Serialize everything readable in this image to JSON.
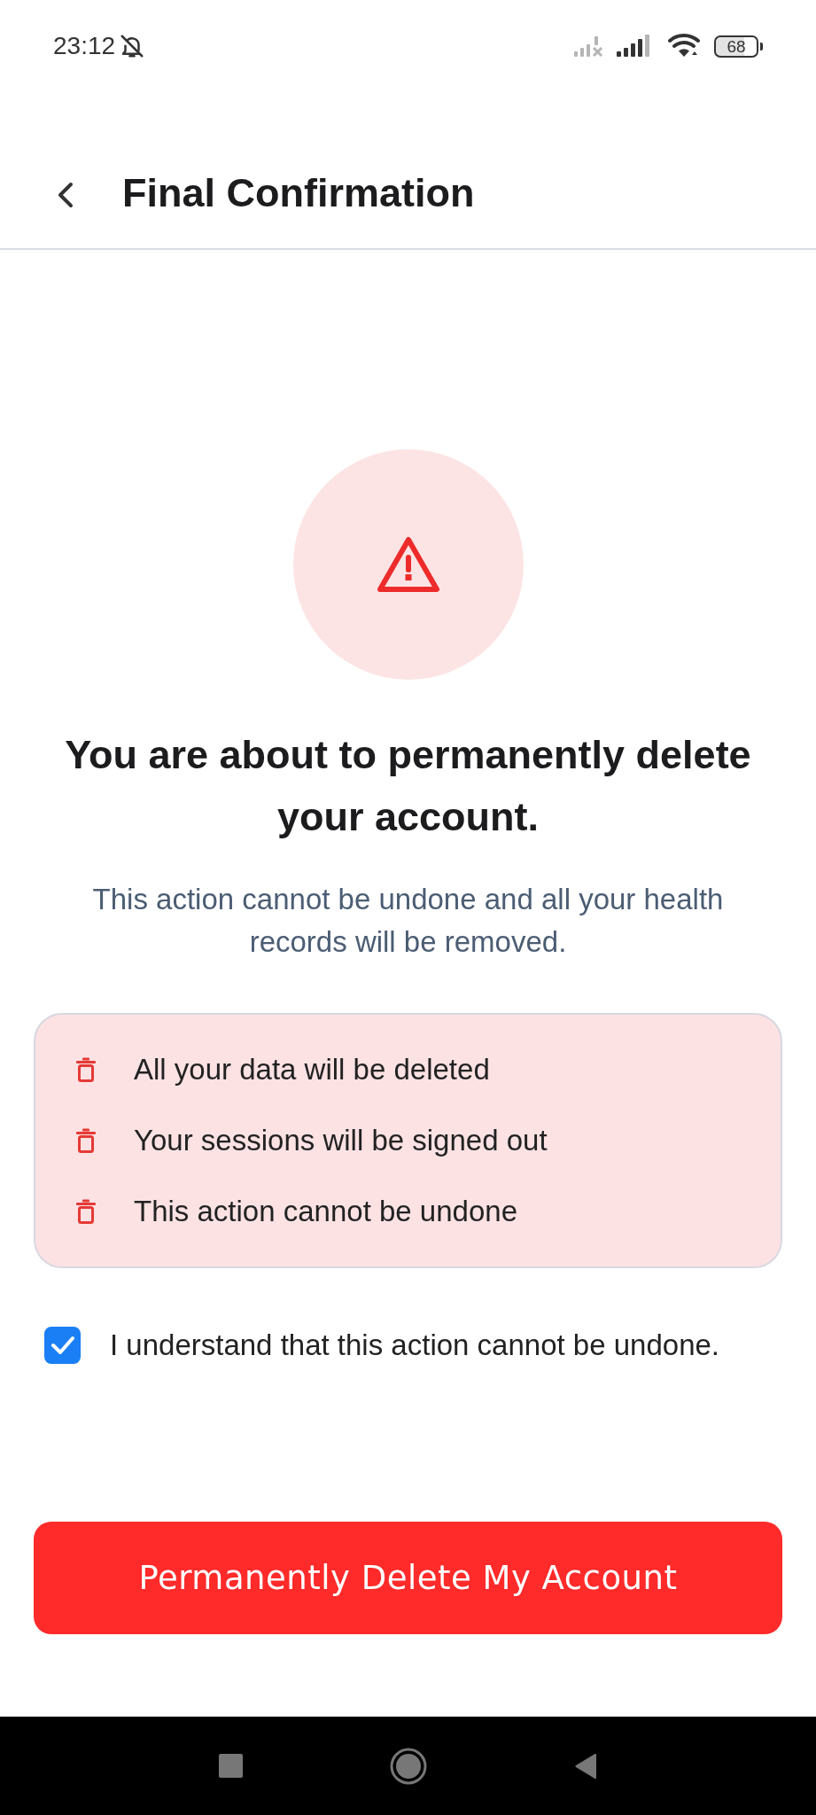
{
  "status_bar": {
    "time": "23:12",
    "battery": "68"
  },
  "header": {
    "title": "Final Confirmation"
  },
  "warning": {
    "heading": "You are about to permanently delete your account.",
    "description": "This action cannot be undone and all your health records will be removed."
  },
  "consequences": [
    {
      "text": "All your data will be deleted"
    },
    {
      "text": "Your sessions will be signed out"
    },
    {
      "text": "This action cannot be undone"
    }
  ],
  "confirm": {
    "label": "I understand that this action cannot be undone.",
    "checked": true
  },
  "delete_button": {
    "label": "Permanently Delete My Account"
  }
}
